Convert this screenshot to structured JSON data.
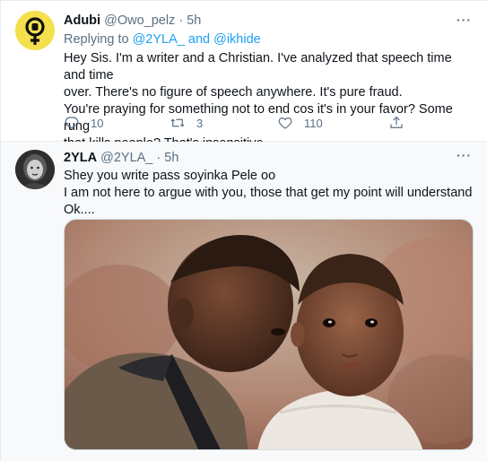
{
  "tweet1": {
    "display_name": "Adubi",
    "handle": "@Owo_pelz",
    "separator": "·",
    "time": "5h",
    "replying_prefix": "Replying to",
    "replying_user1": "@2YLA_",
    "replying_and": "and",
    "replying_user2": "@ikhide",
    "lines": [
      "Hey Sis. I'm a writer and a Christian. I've analyzed that speech time and time",
      "over. There's no figure of speech anywhere. It's pure fraud.",
      "You're praying for something not to end cos it's in your favor? Some rung",
      "that kills people? That's insensitive."
    ],
    "reply_count": "10",
    "retweet_count": "3",
    "like_count": "110",
    "more_label": "···"
  },
  "tweet2": {
    "display_name": "2YLA",
    "handle": "@2YLA_",
    "separator": "·",
    "time": "5h",
    "lines": [
      "Shey you write pass soyinka Pele oo",
      "I am not here to argue with you, those that get my point will understand",
      "Ok...."
    ],
    "more_label": "···"
  },
  "colors": {
    "accent": "#1da1f2",
    "muted": "#5b7083",
    "avatar1_bg": "#f4e04d"
  },
  "icons": {
    "reply": "reply-icon",
    "retweet": "retweet-icon",
    "like": "heart-icon",
    "share": "share-icon",
    "avatar1": "female-symbol-fist-icon"
  }
}
